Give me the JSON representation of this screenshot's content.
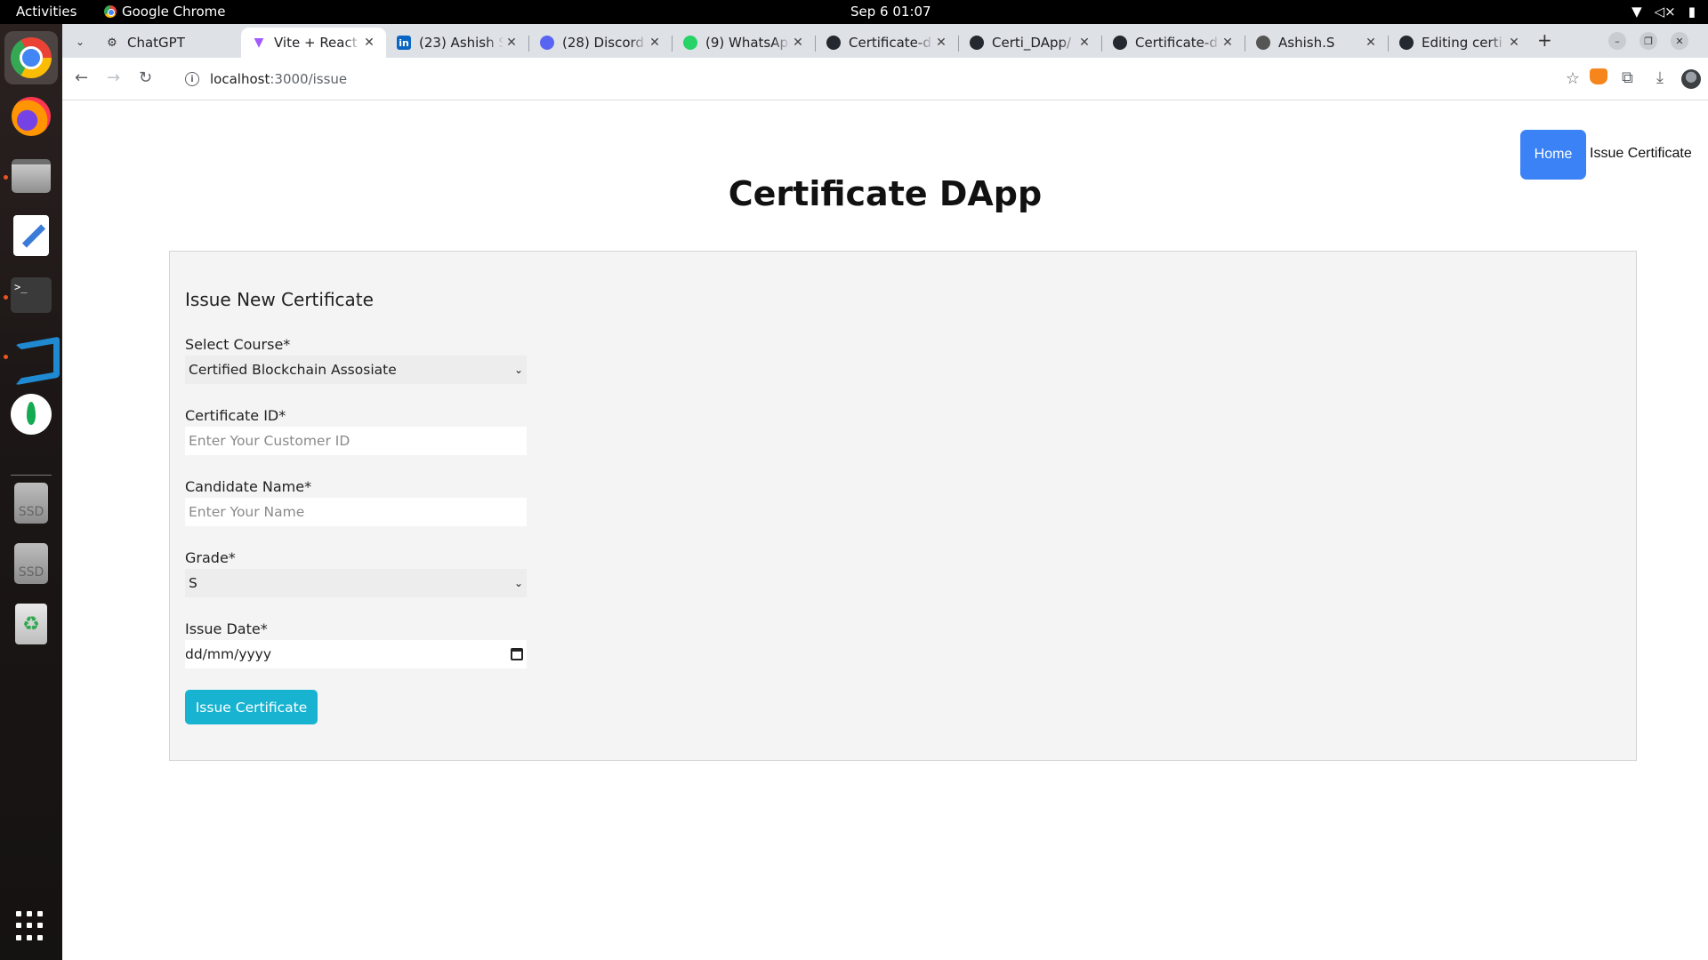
{
  "system": {
    "activities": "Activities",
    "app_name": "Google Chrome",
    "clock": "Sep 6  01:07",
    "dock": {
      "ssd1": "SSD",
      "ssd2": "SSD",
      "terminal_prompt": ">_"
    }
  },
  "browser": {
    "tabs": [
      {
        "title": "ChatGPT",
        "icon": "chatgpt-icon"
      },
      {
        "title": "Vite + React",
        "icon": "vite-icon",
        "active": true
      },
      {
        "title": "(23) Ashish S",
        "icon": "linkedin-icon"
      },
      {
        "title": "(28) Discord |",
        "icon": "discord-icon",
        "badge": "28"
      },
      {
        "title": "(9) WhatsApp",
        "icon": "whatsapp-icon"
      },
      {
        "title": "Certificate-d",
        "icon": "github-icon"
      },
      {
        "title": "Certi_DApp/",
        "icon": "github-icon"
      },
      {
        "title": "Certificate-d",
        "icon": "github-icon"
      },
      {
        "title": "Ashish.S",
        "icon": "globe-icon"
      },
      {
        "title": "Editing certi",
        "icon": "github-icon"
      }
    ],
    "url_host": "localhost",
    "url_path": ":3000/issue"
  },
  "page": {
    "nav": {
      "home": "Home",
      "issue": "Issue Certificate"
    },
    "title": "Certificate DApp",
    "form": {
      "heading": "Issue New Certificate",
      "course_label": "Select Course*",
      "course_value": "Certified Blockchain Assosiate",
      "cert_id_label": "Certificate ID*",
      "cert_id_placeholder": "Enter Your Customer ID",
      "name_label": "Candidate Name*",
      "name_placeholder": "Enter Your Name",
      "grade_label": "Grade*",
      "grade_value": "S",
      "date_label": "Issue Date*",
      "date_placeholder": "dd/mm/yyyy",
      "submit": "Issue Certificate"
    }
  },
  "colors": {
    "home_button": "#3b82f6",
    "submit_button": "#17b3d1",
    "card_background": "#f4f4f4"
  }
}
